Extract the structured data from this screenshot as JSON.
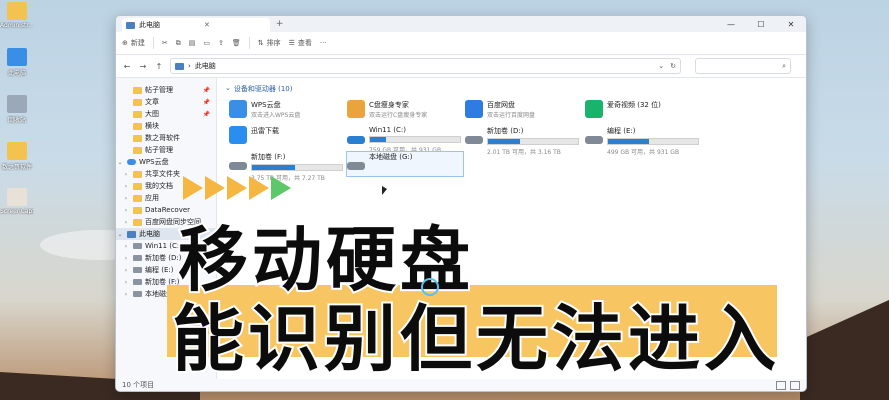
{
  "desktop": {
    "icons": [
      {
        "label": "Administr...",
        "color": "#f3c24f"
      },
      {
        "label": "此电脑",
        "color": "#3a8ee6"
      },
      {
        "label": "回收站",
        "color": "#9aa8b8"
      },
      {
        "label": "数之哥软件",
        "color": "#f3c24f"
      },
      {
        "label": "ScreenCapt... 05_35.mp4",
        "color": "#e8e1d8"
      }
    ]
  },
  "window": {
    "tab_title": "此电脑",
    "controls": {
      "min": "—",
      "max": "☐",
      "close": "✕"
    },
    "toolbar": {
      "new_label": "新建",
      "sort_label": "排序",
      "view_label": "查看",
      "more_label": "···"
    },
    "address": {
      "path_label": "此电脑",
      "search_placeholder": ""
    },
    "sidebar": {
      "items": [
        {
          "label": "帖子管理",
          "type": "folder",
          "pinned": true
        },
        {
          "label": "文章",
          "type": "folder",
          "pinned": true
        },
        {
          "label": "大图",
          "type": "folder",
          "pinned": true
        },
        {
          "label": "横块",
          "type": "folder",
          "pinned": false
        },
        {
          "label": "数之哥软件",
          "type": "folder",
          "pinned": false
        },
        {
          "label": "帖子管理",
          "type": "folder",
          "pinned": false
        },
        {
          "label": "WPS云盘",
          "type": "cloud",
          "pinned": false
        },
        {
          "label": "共享文件夹",
          "type": "folder",
          "pinned": false
        },
        {
          "label": "我的文档",
          "type": "folder",
          "pinned": false
        },
        {
          "label": "应用",
          "type": "folder",
          "pinned": false
        },
        {
          "label": "DataRecover",
          "type": "folder",
          "pinned": false
        },
        {
          "label": "百度网盘同步空间",
          "type": "folder",
          "pinned": false
        },
        {
          "label": "此电脑",
          "type": "pc",
          "pinned": false
        },
        {
          "label": "Win11 (C:)",
          "type": "drive",
          "pinned": false
        },
        {
          "label": "新加卷 (D:)",
          "type": "drive",
          "pinned": false
        },
        {
          "label": "编程 (E:)",
          "type": "drive",
          "pinned": false
        },
        {
          "label": "新加卷 (F:)",
          "type": "drive",
          "pinned": false
        },
        {
          "label": "本地磁盘 (G:)",
          "type": "drive",
          "pinned": false
        }
      ]
    },
    "section_header": "设备和驱动器 (10)",
    "tiles": [
      {
        "name": "WPS云盘",
        "sub": "双击进入WPS云盘",
        "icon_color": "#3a8ee6",
        "has_bar": false
      },
      {
        "name": "C盘瘦身专家",
        "sub": "双击运行C盘瘦身专家",
        "icon_color": "#e9a43b",
        "has_bar": false
      },
      {
        "name": "百度网盘",
        "sub": "双击运行百度网盘",
        "icon_color": "#2f7be3",
        "has_bar": false
      },
      {
        "name": "爱奇视频 (32 位)",
        "sub": "",
        "icon_color": "#19b36b",
        "has_bar": false
      },
      {
        "name": "迅雷下载",
        "sub": "",
        "icon_color": "#2a8ef0",
        "has_bar": false
      },
      {
        "name": "Win11 (C:)",
        "sub": "759 GB 可用，共 931 GB",
        "icon_color": "#2a7fd1",
        "has_bar": true,
        "fill": 0.18
      },
      {
        "name": "新加卷 (D:)",
        "sub": "2.01 TB 可用，共 3.16 TB",
        "icon_color": "#7f8a96",
        "has_bar": true,
        "fill": 0.36
      },
      {
        "name": "编程 (E:)",
        "sub": "499 GB 可用，共 931 GB",
        "icon_color": "#7f8a96",
        "has_bar": true,
        "fill": 0.46
      },
      {
        "name": "新加卷 (F:)",
        "sub": "3.75 TB 可用，共 7.27 TB",
        "icon_color": "#7f8a96",
        "has_bar": true,
        "fill": 0.48
      },
      {
        "name": "本地磁盘 (G:)",
        "sub": "",
        "icon_color": "#7f8a96",
        "has_bar": false
      }
    ],
    "status_text": "10 个项目"
  },
  "overlay": {
    "line1": "移动硬盘",
    "line2": "能识别但无法进入",
    "arrow_colors": [
      "#f5b642",
      "#f5b642",
      "#f5b642",
      "#f5b642",
      "#5cc86a"
    ]
  }
}
